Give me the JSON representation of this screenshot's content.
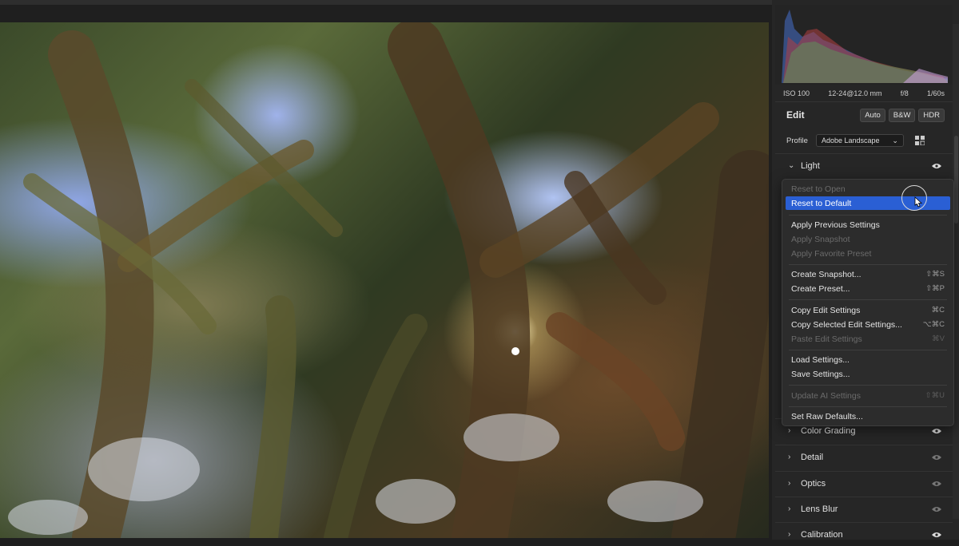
{
  "exif": {
    "iso": "ISO 100",
    "lens": "12-24@12.0 mm",
    "aperture": "f/8",
    "shutter": "1/60s"
  },
  "edit": {
    "title": "Edit",
    "buttons": [
      "Auto",
      "B&W",
      "HDR"
    ]
  },
  "profile": {
    "label": "Profile",
    "value": "Adobe Landscape"
  },
  "sections": [
    {
      "label": "Light",
      "expanded": true,
      "eye": "eye-icon"
    },
    {
      "label": "Color Grading",
      "expanded": false,
      "eye": "eye-icon"
    },
    {
      "label": "Detail",
      "expanded": false,
      "eye": "eye-icon"
    },
    {
      "label": "Optics",
      "expanded": false,
      "eye": "eye-icon"
    },
    {
      "label": "Lens Blur",
      "expanded": false,
      "eye": "eye-icon"
    },
    {
      "label": "Calibration",
      "expanded": false,
      "eye": "eye-icon"
    }
  ],
  "menu": {
    "items": [
      {
        "label": "Reset to Open",
        "shortcut": "",
        "disabled": true
      },
      {
        "label": "Reset to Default",
        "shortcut": "",
        "disabled": false,
        "highlighted": true
      },
      {
        "label": "Apply Previous Settings",
        "shortcut": "",
        "disabled": false
      },
      {
        "label": "Apply Snapshot",
        "shortcut": "",
        "disabled": true
      },
      {
        "label": "Apply Favorite Preset",
        "shortcut": "",
        "disabled": true
      },
      {
        "label": "Create Snapshot...",
        "shortcut": "⇧⌘S",
        "disabled": false
      },
      {
        "label": "Create Preset...",
        "shortcut": "⇧⌘P",
        "disabled": false
      },
      {
        "label": "Copy Edit Settings",
        "shortcut": "⌘C",
        "disabled": false
      },
      {
        "label": "Copy Selected Edit Settings...",
        "shortcut": "⌥⌘C",
        "disabled": false
      },
      {
        "label": "Paste Edit Settings",
        "shortcut": "⌘V",
        "disabled": true
      },
      {
        "label": "Load Settings...",
        "shortcut": "",
        "disabled": false
      },
      {
        "label": "Save Settings...",
        "shortcut": "",
        "disabled": false
      },
      {
        "label": "Update AI Settings",
        "shortcut": "⇧⌘U",
        "disabled": true
      },
      {
        "label": "Set Raw Defaults...",
        "shortcut": "",
        "disabled": false
      }
    ]
  },
  "colors": {
    "accent": "#2a5fd4",
    "panel": "#262626"
  }
}
